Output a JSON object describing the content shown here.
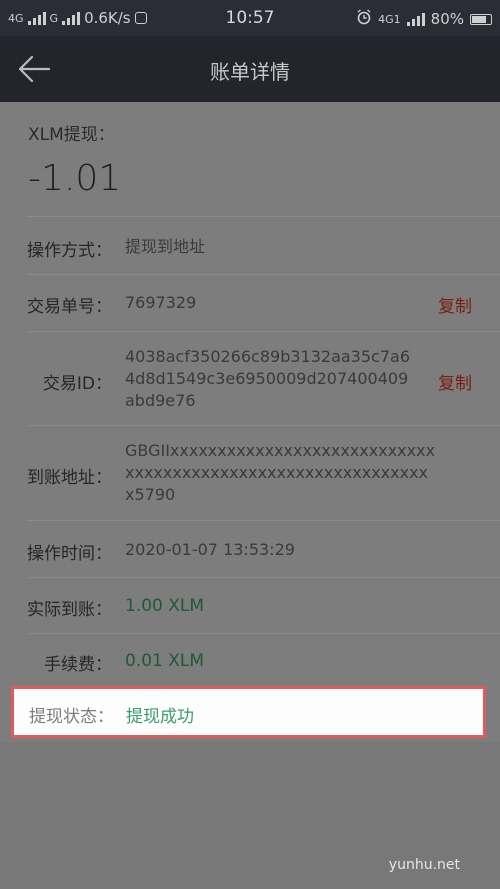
{
  "status_bar": {
    "network1": "4G",
    "network2": "G",
    "speed": "0.6K/s",
    "time": "10:57",
    "network3": "4G1",
    "battery": "80%"
  },
  "navbar": {
    "title": "账单详情"
  },
  "detail": {
    "header_label": "XLM提现：",
    "amount": "-1.01",
    "rows": [
      {
        "label": "操作方式：",
        "value": "提现到地址"
      },
      {
        "label": "交易单号：",
        "value": "7697329",
        "action": "复制"
      },
      {
        "label": "交易ID：",
        "value_lines": [
          "4038acf350266c89b3132aa35c7a6",
          "4d8d1549c3e6950009d207400409",
          "abd9e76"
        ],
        "action": "复制"
      },
      {
        "label": "到账地址：",
        "value_lines": [
          "GBGIIxxxxxxxxxxxxxxxxxxxxxxxxxxxx",
          "xxxxxxxxxxxxxxxxxxxxxxxxxxxxxxxx",
          "x5790"
        ]
      },
      {
        "label": "操作时间：",
        "value": "2020-01-07 13:53:29"
      },
      {
        "label": "实际到账：",
        "value": "1.00 XLM"
      },
      {
        "label": "手续费：",
        "value": "0.01 XLM"
      }
    ],
    "status": {
      "label": "提现状态：",
      "value": "提现成功"
    }
  },
  "watermark": "yunhu.net",
  "colors": {
    "copy": "#7a1e10",
    "green_value": "#1f5a35",
    "success": "#3aa06a",
    "highlight_border": "#e05c5c"
  }
}
